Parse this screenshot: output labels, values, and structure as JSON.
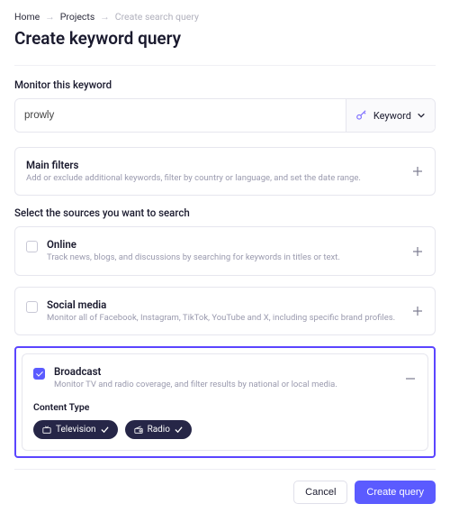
{
  "breadcrumb": {
    "home": "Home",
    "projects": "Projects",
    "current": "Create search query"
  },
  "page_title": "Create keyword query",
  "monitor_label": "Monitor this keyword",
  "keyword_value": "prowly",
  "keyword_selector": {
    "label": "Keyword"
  },
  "main_filters": {
    "title": "Main filters",
    "desc": "Add or exclude additional keywords, filter by country or language, and set the date range."
  },
  "sources_label": "Select the sources you want to search",
  "sources": {
    "online": {
      "title": "Online",
      "desc": "Track news, blogs, and discussions by searching for keywords in titles or text."
    },
    "social": {
      "title": "Social media",
      "desc": "Monitor all of Facebook, Instagram, TikTok, YouTube and X, including specific brand profiles."
    },
    "broadcast": {
      "title": "Broadcast",
      "desc": "Monitor TV and radio coverage, and filter results by national or local media.",
      "content_type_label": "Content Type",
      "chips": {
        "tv": "Television",
        "radio": "Radio"
      }
    }
  },
  "footer": {
    "cancel": "Cancel",
    "create": "Create query"
  }
}
